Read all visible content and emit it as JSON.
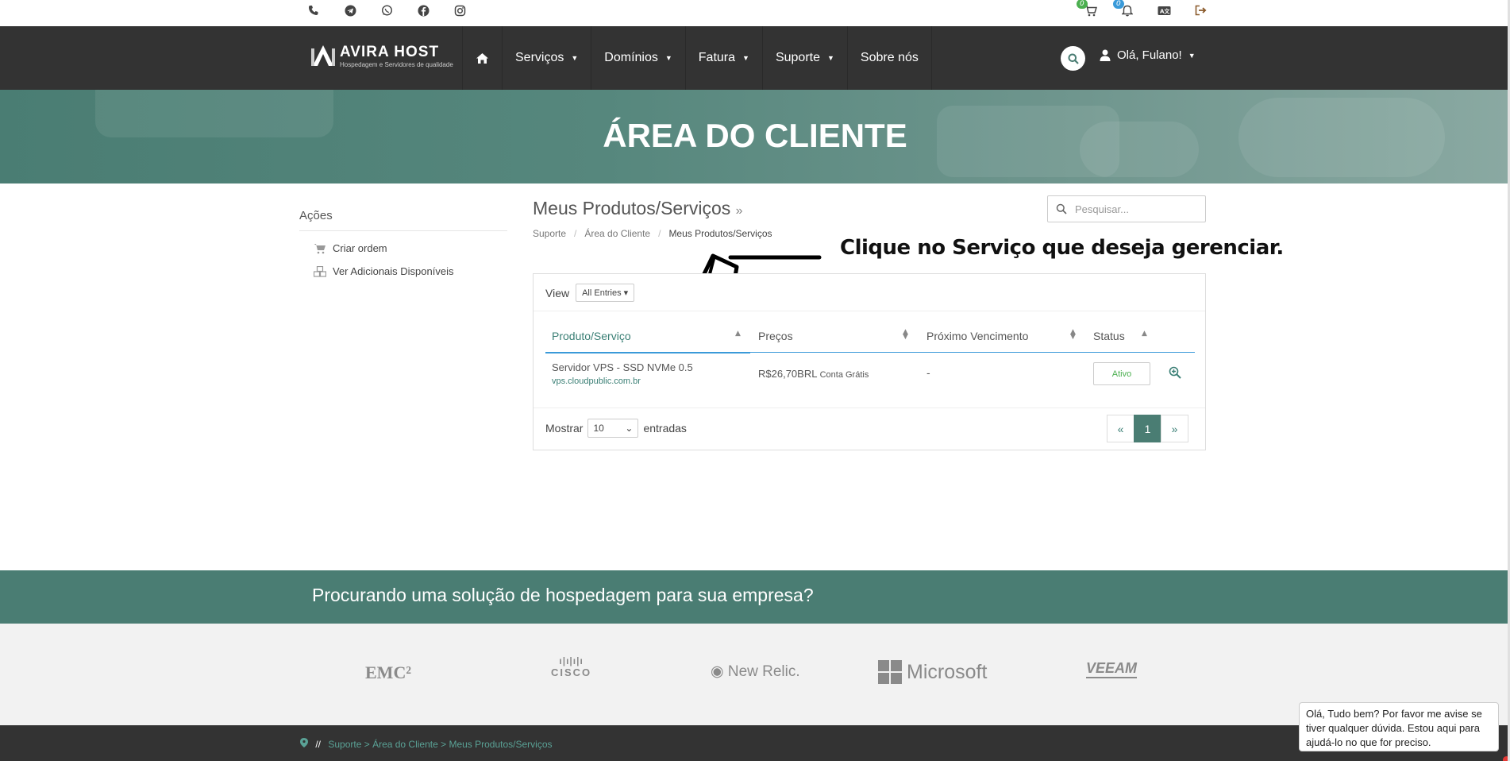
{
  "topbar": {
    "social_icons": [
      "phone-icon",
      "telegram-icon",
      "whatsapp-icon",
      "facebook-icon",
      "instagram-icon"
    ],
    "cart_count": "0",
    "notify_count": "0"
  },
  "navbar": {
    "logo_name": "AVIRA HOST",
    "logo_tagline": "Hospedagem e Servidores de qualidade",
    "items": [
      "Serviços",
      "Domínios",
      "Fatura",
      "Suporte",
      "Sobre nós"
    ],
    "user_greeting": "Olá, Fulano!"
  },
  "hero": {
    "title": "ÁREA DO CLIENTE"
  },
  "sidebar": {
    "title": "Ações",
    "links": [
      "Criar ordem",
      "Ver Adicionais Disponíveis"
    ]
  },
  "main": {
    "title": "Meus Produtos/Serviços",
    "breadcrumb": [
      "Suporte",
      "Área do Cliente",
      "Meus Produtos/Serviços"
    ],
    "search_placeholder": "Pesquisar...",
    "annotation": "Clique no Serviço que deseja gerenciar.",
    "view_label": "View",
    "view_value": "All Entries",
    "columns": [
      "Produto/Serviço",
      "Preços",
      "Próximo Vencimento",
      "Status"
    ],
    "rows": [
      {
        "product": "Servidor VPS - SSD NVMe 0.5",
        "domain": "vps.cloudpublic.com.br",
        "price": "R$26,70BRL",
        "cycle": "Conta Grátis",
        "due": "-",
        "status": "Ativo"
      }
    ],
    "show_label": "Mostrar",
    "show_value": "10",
    "entries_label": "entradas",
    "page_prev": "«",
    "page_current": "1",
    "page_next": "»"
  },
  "promo": {
    "text": "Procurando uma solução de hospedagem para sua empresa?"
  },
  "partners": [
    "EMC²",
    "CISCO",
    "New Relic.",
    "Microsoft",
    "VEEAM"
  ],
  "footer": {
    "crumb_slash": "//",
    "crumb": "Suporte > Área do Cliente > Meus Produtos/Serviços"
  },
  "chat": {
    "message": "Olá, Tudo bem? Por favor me avise se tiver qualquer dúvida. Estou aqui para ajudá-lo no que for preciso."
  },
  "colors": {
    "primary": "#4a7d73",
    "dark": "#333333",
    "accent": "#3a9ad9",
    "success": "#4caf50"
  }
}
